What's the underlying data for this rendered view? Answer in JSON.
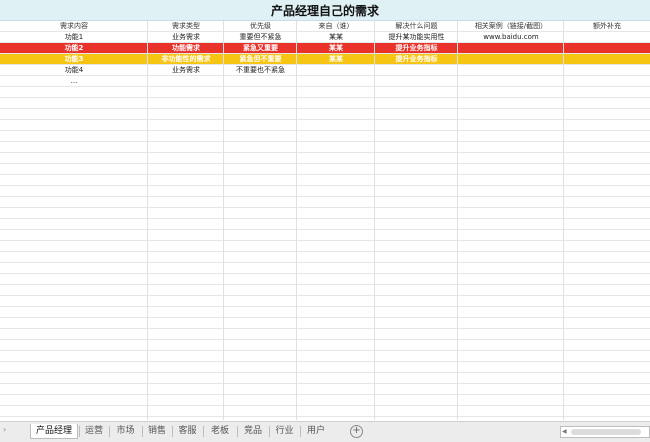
{
  "title": "产品经理自己的需求",
  "columns": [
    "需求内容",
    "需求类型",
    "优先级",
    "来自（谁）",
    "解决什么问题",
    "相关案例（链接/截图）",
    "额外补充"
  ],
  "rows": [
    {
      "style": "normal",
      "cells": [
        "功能1",
        "业务需求",
        "重要但不紧急",
        "某某",
        "提升某功能实用性",
        "www.baidu.com",
        ""
      ]
    },
    {
      "style": "red",
      "cells": [
        "功能2",
        "功能需求",
        "紧急又重要",
        "某某",
        "提升业务指标",
        "",
        ""
      ]
    },
    {
      "style": "yellow",
      "cells": [
        "功能3",
        "非功能性的需求",
        "紧急但不重要",
        "某某",
        "提升业务指标",
        "",
        ""
      ]
    },
    {
      "style": "normal",
      "cells": [
        "功能4",
        "业务需求",
        "不重要也不紧急",
        "",
        "",
        "",
        ""
      ]
    },
    {
      "style": "normal",
      "cells": [
        "...",
        "",
        "",
        "",
        "",
        "",
        ""
      ]
    }
  ],
  "sheet_tabs": [
    "产品经理",
    "运营",
    "市场",
    "销售",
    "客服",
    "老板",
    "竞品",
    "行业",
    "用户"
  ],
  "active_tab": "产品经理",
  "add_sheet_symbol": "+",
  "nav_symbol": "›"
}
